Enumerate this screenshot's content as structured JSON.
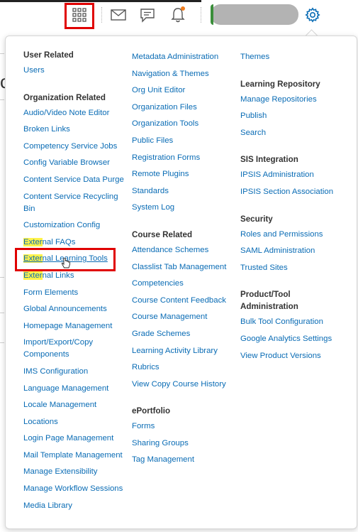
{
  "topbar": {
    "icons": [
      "apps-grid-icon",
      "mail-icon",
      "chat-icon",
      "bell-icon",
      "gear-icon"
    ],
    "colors": {
      "highlight_frame": "#e00000",
      "notification_dot": "#f07d1e",
      "link": "#0a6cb5",
      "text_highlight": "#fff34a"
    }
  },
  "menu": {
    "col1": {
      "sections": [
        {
          "heading": "User Related",
          "items": [
            "Users"
          ]
        },
        {
          "heading": "Organization Related",
          "items": [
            "Audio/Video Note Editor",
            "Broken Links",
            "Competency Service Jobs",
            "Config Variable Browser",
            "Content Service Data Purge",
            "Content Service Recycling Bin",
            "Customization Config",
            "External FAQs",
            "External Learning Tools",
            "External Links",
            "Form Elements",
            "Global Announcements",
            "Homepage Management",
            "Import/Export/Copy Components",
            "IMS Configuration",
            "Language Management",
            "Locale Management",
            "Locations",
            "Login Page Management",
            "Mail Template Management",
            "Manage Extensibility",
            "Manage Workflow Sessions",
            "Media Library"
          ]
        }
      ]
    },
    "col2": {
      "sections": [
        {
          "heading": "",
          "items": [
            "Metadata Administration",
            "Navigation & Themes",
            "Org Unit Editor",
            "Organization Files",
            "Organization Tools",
            "Public Files",
            "Registration Forms",
            "Remote Plugins",
            "Standards",
            "System Log"
          ]
        },
        {
          "heading": "Course Related",
          "items": [
            "Attendance Schemes",
            "Classlist Tab Management",
            "Competencies",
            "Course Content Feedback",
            "Course Management",
            "Grade Schemes",
            "Learning Activity Library",
            "Rubrics",
            "View Copy Course History"
          ]
        },
        {
          "heading": "ePortfolio",
          "items": [
            "Forms",
            "Sharing Groups",
            "Tag Management"
          ]
        }
      ]
    },
    "col3": {
      "sections": [
        {
          "heading": "",
          "items": [
            "Themes"
          ]
        },
        {
          "heading": "Learning Repository",
          "items": [
            "Manage Repositories",
            "Publish",
            "Search"
          ]
        },
        {
          "heading": "SIS Integration",
          "items": [
            "IPSIS Administration",
            "IPSIS Section Association"
          ]
        },
        {
          "heading": "Security",
          "items": [
            "Roles and Permissions",
            "SAML Administration",
            "Trusted Sites"
          ]
        },
        {
          "heading": "Product/Tool Administration",
          "items": [
            "Bulk Tool Configuration",
            "Google Analytics Settings",
            "View Product Versions"
          ]
        }
      ]
    },
    "highlight_prefix": "Exter",
    "background_fragment": "c"
  }
}
